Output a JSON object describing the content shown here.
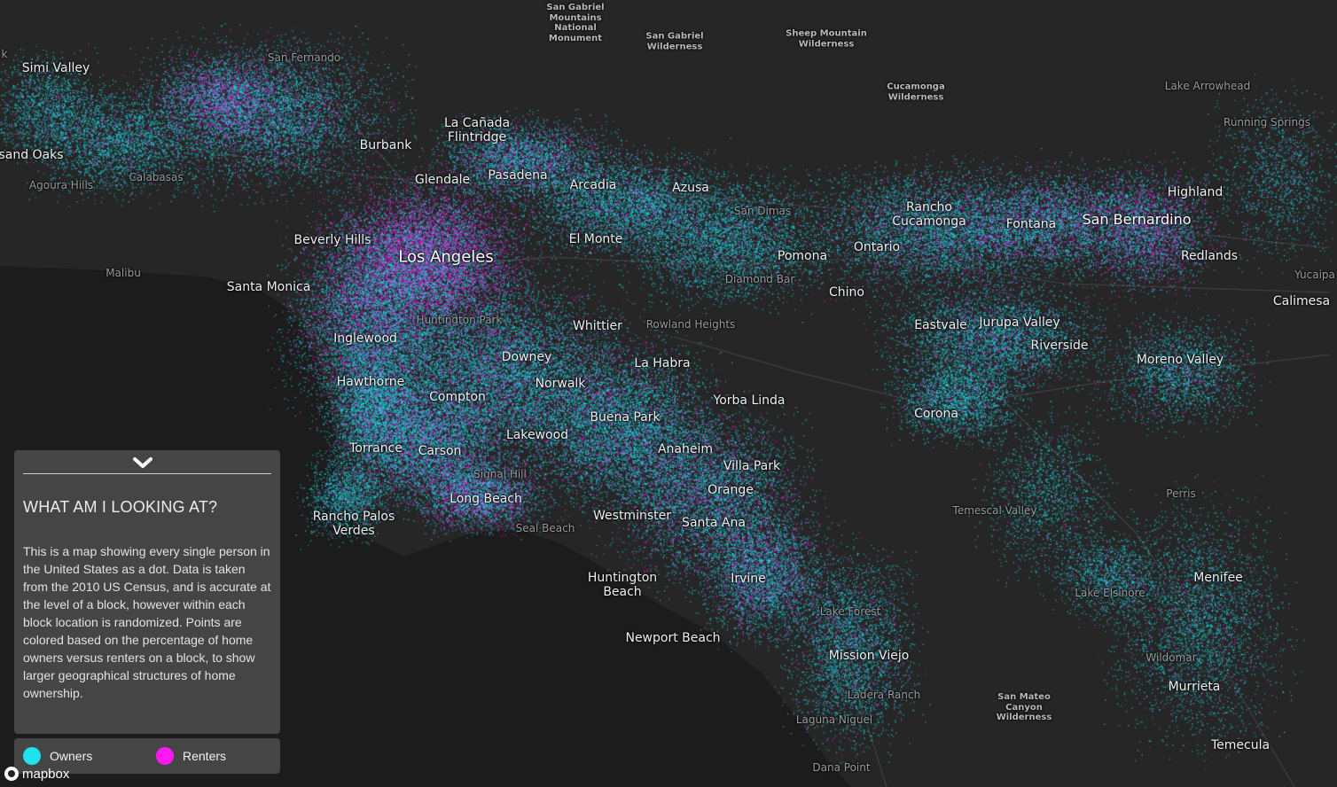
{
  "map": {
    "labels": [
      {
        "text": "Los Angeles",
        "cls": "major"
      },
      {
        "text": "San Bernardino",
        "cls": "big"
      },
      {
        "text": "Simi Valley",
        "cls": "city"
      },
      {
        "text": "sand Oaks",
        "cls": "city"
      },
      {
        "text": "Burbank",
        "cls": "city"
      },
      {
        "text": "La Cañada Flintridge",
        "cls": "city"
      },
      {
        "text": "Glendale",
        "cls": "city"
      },
      {
        "text": "Pasadena",
        "cls": "city"
      },
      {
        "text": "Arcadia",
        "cls": "city"
      },
      {
        "text": "Azusa",
        "cls": "city"
      },
      {
        "text": "Beverly Hills",
        "cls": "city"
      },
      {
        "text": "El Monte",
        "cls": "city"
      },
      {
        "text": "Santa Monica",
        "cls": "city"
      },
      {
        "text": "Pomona",
        "cls": "city"
      },
      {
        "text": "Ontario",
        "cls": "city"
      },
      {
        "text": "Rancho Cucamonga",
        "cls": "city"
      },
      {
        "text": "Fontana",
        "cls": "city"
      },
      {
        "text": "Highland",
        "cls": "city"
      },
      {
        "text": "Redlands",
        "cls": "city"
      },
      {
        "text": "Calimesa",
        "cls": "city"
      },
      {
        "text": "Chino",
        "cls": "city"
      },
      {
        "text": "Whittier",
        "cls": "city"
      },
      {
        "text": "Inglewood",
        "cls": "city"
      },
      {
        "text": "Downey",
        "cls": "city"
      },
      {
        "text": "La Habra",
        "cls": "city"
      },
      {
        "text": "Eastvale",
        "cls": "city"
      },
      {
        "text": "Jurupa Valley",
        "cls": "city"
      },
      {
        "text": "Riverside",
        "cls": "city"
      },
      {
        "text": "Moreno Valley",
        "cls": "city"
      },
      {
        "text": "Hawthorne",
        "cls": "city"
      },
      {
        "text": "Norwalk",
        "cls": "city"
      },
      {
        "text": "Compton",
        "cls": "city"
      },
      {
        "text": "Yorba Linda",
        "cls": "city"
      },
      {
        "text": "Buena Park",
        "cls": "city"
      },
      {
        "text": "Corona",
        "cls": "city"
      },
      {
        "text": "Lakewood",
        "cls": "city"
      },
      {
        "text": "Torrance",
        "cls": "city"
      },
      {
        "text": "Carson",
        "cls": "city"
      },
      {
        "text": "Anaheim",
        "cls": "city"
      },
      {
        "text": "Villa Park",
        "cls": "city"
      },
      {
        "text": "Orange",
        "cls": "city"
      },
      {
        "text": "Long Beach",
        "cls": "city"
      },
      {
        "text": "Rancho Palos Verdes",
        "cls": "city"
      },
      {
        "text": "Westminster",
        "cls": "city"
      },
      {
        "text": "Santa Ana",
        "cls": "city"
      },
      {
        "text": "Huntington Beach",
        "cls": "city"
      },
      {
        "text": "Irvine",
        "cls": "city"
      },
      {
        "text": "Menifee",
        "cls": "city"
      },
      {
        "text": "Newport Beach",
        "cls": "city"
      },
      {
        "text": "Mission Viejo",
        "cls": "city"
      },
      {
        "text": "Murrieta",
        "cls": "city"
      },
      {
        "text": "Temecula",
        "cls": "city"
      },
      {
        "text": "San Fernando",
        "cls": "minor"
      },
      {
        "text": "Agoura Hills",
        "cls": "minor"
      },
      {
        "text": "Calabasas",
        "cls": "minor"
      },
      {
        "text": "Malibu",
        "cls": "minor"
      },
      {
        "text": "San Dimas",
        "cls": "minor"
      },
      {
        "text": "Diamond Bar",
        "cls": "minor"
      },
      {
        "text": "Rowland Heights",
        "cls": "minor"
      },
      {
        "text": "Huntington Park",
        "cls": "minor"
      },
      {
        "text": "Signal Hill",
        "cls": "minor"
      },
      {
        "text": "Seal Beach",
        "cls": "minor"
      },
      {
        "text": "Temescal Valley",
        "cls": "minor"
      },
      {
        "text": "Perris",
        "cls": "minor"
      },
      {
        "text": "Lake Elsinore",
        "cls": "minor"
      },
      {
        "text": "Lake Forest",
        "cls": "minor"
      },
      {
        "text": "Ladera Ranch",
        "cls": "minor"
      },
      {
        "text": "Laguna Niguel",
        "cls": "minor"
      },
      {
        "text": "Dana Point",
        "cls": "minor"
      },
      {
        "text": "Wildomar",
        "cls": "minor"
      },
      {
        "text": "Lake Arrowhead",
        "cls": "minor"
      },
      {
        "text": "Running Springs",
        "cls": "minor"
      },
      {
        "text": "Yucaipa",
        "cls": "minor"
      },
      {
        "text": "k",
        "cls": "minor"
      },
      {
        "text": "San Gabriel Mountains National Monument",
        "cls": "wild"
      },
      {
        "text": "San Gabriel Wilderness",
        "cls": "wild"
      },
      {
        "text": "Sheep Mountain Wilderness",
        "cls": "wild"
      },
      {
        "text": "Cucamonga Wilderness",
        "cls": "wild"
      },
      {
        "text": "San Mateo Canyon Wilderness",
        "cls": "wild"
      }
    ]
  },
  "panel": {
    "title": "WHAT AM I LOOKING AT?",
    "body": "This is a map showing every single person in the United States as a dot. Data is taken from the 2010 US Census, and is accurate at the level of a block, however within each block location is randomized. Points are colored based on the percentage of home owners versus renters on a block, to show larger geographical structures of home ownership.",
    "toggle_icon": "chevron-down-icon"
  },
  "legend": {
    "items": [
      {
        "label": "Owners",
        "color": "#1ee3ef"
      },
      {
        "label": "Renters",
        "color": "#ff19f0"
      }
    ]
  },
  "attribution": {
    "text": "mapbox",
    "icon": "mapbox-logo-icon"
  },
  "colors": {
    "ocean": "#1d1d1d",
    "land": "#262626",
    "owners": "#1ee3ef",
    "renters": "#ff19f0"
  }
}
